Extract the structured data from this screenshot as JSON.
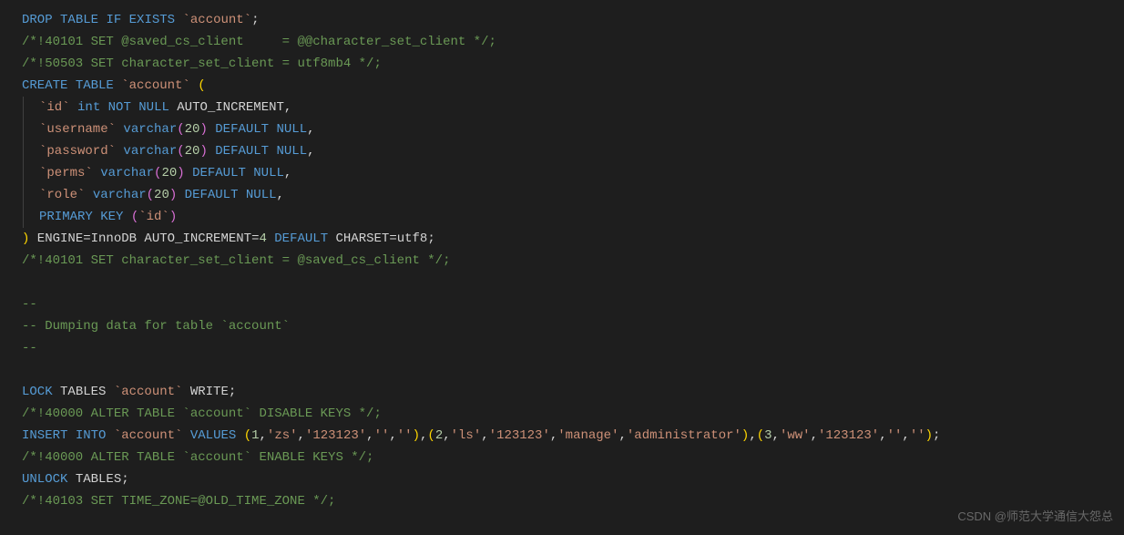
{
  "code": {
    "line1": {
      "drop": "DROP",
      "table": "TABLE",
      "if": "IF",
      "exists": "EXISTS",
      "account": "`account`",
      "semi": ";"
    },
    "line2": "/*!40101 SET @saved_cs_client     = @@character_set_client */;",
    "line3": "/*!50503 SET character_set_client = utf8mb4 */;",
    "line4": {
      "create": "CREATE",
      "table": "TABLE",
      "account": "`account`",
      "paren": " ("
    },
    "line5": {
      "id": "`id`",
      "int": "int",
      "not": "NOT",
      "null": "NULL",
      "auto": " AUTO_INCREMENT,"
    },
    "line6": {
      "username": "`username`",
      "varchar": "varchar",
      "paren_open": "(",
      "num": "20",
      "paren_close": ")",
      "default": "DEFAULT",
      "null": "NULL",
      "comma": ","
    },
    "line7": {
      "password": "`password`",
      "varchar": "varchar",
      "paren_open": "(",
      "num": "20",
      "paren_close": ")",
      "default": "DEFAULT",
      "null": "NULL",
      "comma": ","
    },
    "line8": {
      "perms": "`perms`",
      "varchar": "varchar",
      "paren_open": "(",
      "num": "20",
      "paren_close": ")",
      "default": "DEFAULT",
      "null": "NULL",
      "comma": ","
    },
    "line9": {
      "role": "`role`",
      "varchar": "varchar",
      "paren_open": "(",
      "num": "20",
      "paren_close": ")",
      "default": "DEFAULT",
      "null": "NULL",
      "comma": ","
    },
    "line10": {
      "primary": "PRIMARY",
      "key": "KEY",
      "paren_open": " (",
      "id": "`id`",
      "paren_close": ")"
    },
    "line11": {
      "paren": ")",
      "engine": " ENGINE",
      "eq1": "=",
      "innodb": "InnoDB AUTO_INCREMENT",
      "eq2": "=",
      "four": "4",
      "default": "DEFAULT",
      "charset": " CHARSET",
      "eq3": "=",
      "utf8": "utf8;"
    },
    "line12": "/*!40101 SET character_set_client = @saved_cs_client */;",
    "line13": "",
    "line14": "--",
    "line15": "-- Dumping data for table `account`",
    "line16": "--",
    "line17": "",
    "line18": {
      "lock": "LOCK",
      "tables": " TABLES ",
      "account": "`account`",
      "write": " WRITE;"
    },
    "line19": "/*!40000 ALTER TABLE `account` DISABLE KEYS */;",
    "line20": {
      "insert": "INSERT",
      "into": "INTO",
      "account": "`account`",
      "values": "VALUES",
      "p1o": " (",
      "v1": "1",
      "c": ",",
      "zs": "'zs'",
      "n123123_1": "'123123'",
      "empty": "''",
      "p1c": ")",
      "comma_out": ",",
      "p2o": "(",
      "v2": "2",
      "ls": "'ls'",
      "manage": "'manage'",
      "admin": "'administrator'",
      "p2c": ")",
      "p3o": "(",
      "v3": "3",
      "ww": "'ww'",
      "p3c": ")",
      "semi": ";"
    },
    "line21": "/*!40000 ALTER TABLE `account` ENABLE KEYS */;",
    "line22": {
      "unlock": "UNLOCK",
      "tables": " TABLES;"
    },
    "line23": "/*!40103 SET TIME_ZONE=@OLD_TIME_ZONE */;"
  },
  "watermark": "CSDN @师范大学通信大怨总"
}
